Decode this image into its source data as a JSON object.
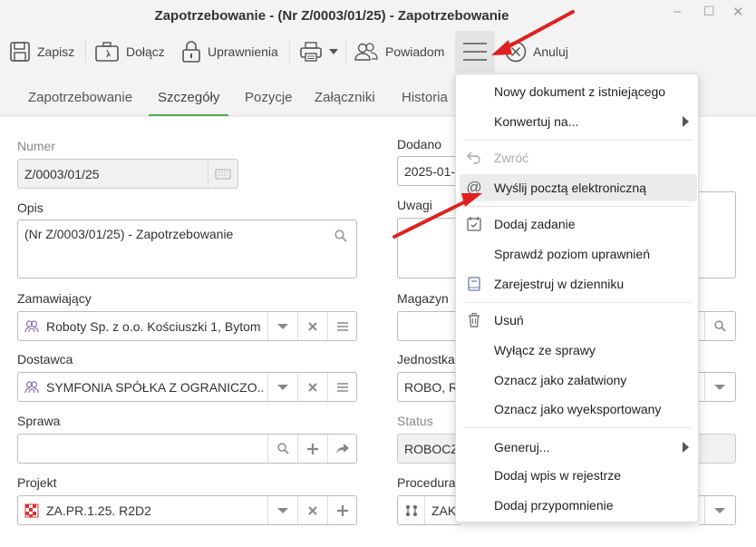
{
  "window": {
    "title": "Zapotrzebowanie - (Nr Z/0003/01/25) - Zapotrzebowanie",
    "minimize": "–",
    "maximize": "☐",
    "close": "✕"
  },
  "toolbar": {
    "save": "Zapisz",
    "attach": "Dołącz",
    "permissions": "Uprawnienia",
    "notify": "Powiadom",
    "cancel": "Anuluj"
  },
  "tabs": [
    {
      "label": "Zapotrzebowanie",
      "active": false
    },
    {
      "label": "Szczegóły",
      "active": true
    },
    {
      "label": "Pozycje",
      "active": false
    },
    {
      "label": "Załączniki",
      "active": false
    },
    {
      "label": "Historia",
      "active": false
    }
  ],
  "form": {
    "numer_label": "Numer",
    "numer_value": "Z/0003/01/25",
    "dodano_label": "Dodano",
    "dodano_value": "2025-01-",
    "opis_label": "Opis",
    "opis_value": "(Nr Z/0003/01/25) - Zapotrzebowanie",
    "uwagi_label": "Uwagi",
    "zamawiajacy_label": "Zamawiający",
    "zamawiajacy_value": "Roboty Sp. z o.o. Kościuszki 1, Bytom",
    "magazyn_label": "Magazyn",
    "dostawca_label": "Dostawca",
    "dostawca_value": "SYMFONIA SPÓŁKA Z OGRANICZO...",
    "jednostka_label": "Jednostka",
    "jednostka_value": "ROBO, Ro",
    "sprawa_label": "Sprawa",
    "status_label": "Status",
    "status_value": "ROBOCZ",
    "projekt_label": "Projekt",
    "projekt_value": "ZA.PR.1.25. R2D2",
    "procedura_label": "Procedura",
    "procedura_value": "ZAK"
  },
  "menu": {
    "items": [
      {
        "label": "Nowy dokument z istniejącego",
        "icon": "",
        "submenu": false,
        "disabled": false
      },
      {
        "label": "Konwertuj na...",
        "icon": "",
        "submenu": true,
        "disabled": false
      },
      {
        "label": "Zwróć",
        "icon": "undo-icon",
        "submenu": false,
        "disabled": true
      },
      {
        "label": "Wyślij pocztą elektroniczną",
        "icon": "at-icon",
        "submenu": false,
        "disabled": false,
        "highlighted": true
      },
      {
        "label": "Dodaj zadanie",
        "icon": "calendar-check-icon",
        "submenu": false,
        "disabled": false
      },
      {
        "label": "Sprawdź poziom uprawnień",
        "icon": "",
        "submenu": false,
        "disabled": false
      },
      {
        "label": "Zarejestruj w dzienniku",
        "icon": "journal-icon",
        "submenu": false,
        "disabled": false
      },
      {
        "label": "Usuń",
        "icon": "trash-icon",
        "submenu": false,
        "disabled": false
      },
      {
        "label": "Wyłącz ze sprawy",
        "icon": "",
        "submenu": false,
        "disabled": false
      },
      {
        "label": "Oznacz jako załatwiony",
        "icon": "",
        "submenu": false,
        "disabled": false
      },
      {
        "label": "Oznacz jako wyeksportowany",
        "icon": "",
        "submenu": false,
        "disabled": false
      },
      {
        "label": "Generuj...",
        "icon": "",
        "submenu": true,
        "disabled": false
      },
      {
        "label": "Dodaj wpis w rejestrze",
        "icon": "",
        "submenu": false,
        "disabled": false
      },
      {
        "label": "Dodaj przypomnienie",
        "icon": "",
        "submenu": false,
        "disabled": false
      }
    ]
  },
  "colors": {
    "accent_tab": "#4caf50",
    "annotation_arrow": "#e02020"
  }
}
